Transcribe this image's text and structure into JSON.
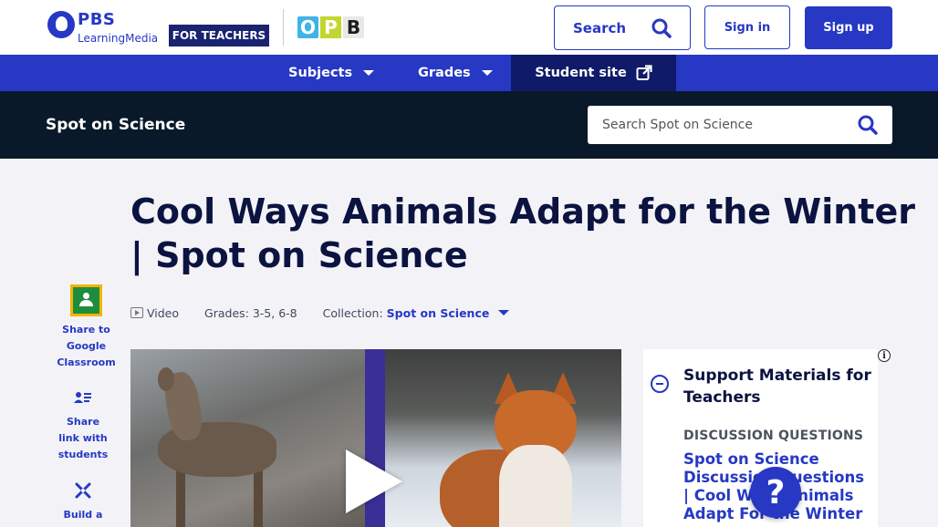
{
  "header": {
    "logo_pbs": "PBS",
    "logo_learning_media": "LearningMedia",
    "for_teachers": "FOR TEACHERS",
    "opb_letters": [
      "O",
      "P",
      "B"
    ],
    "search_label": "Search",
    "sign_in": "Sign in",
    "sign_up": "Sign up"
  },
  "nav": {
    "subjects": "Subjects",
    "grades": "Grades",
    "student_site": "Student site"
  },
  "collection": {
    "title": "Spot on Science",
    "search_placeholder": "Search Spot on Science"
  },
  "page": {
    "title": "Cool Ways Animals Adapt for the Winter | Spot on Science",
    "media_type": "Video",
    "grades": "Grades: 3-5, 6-8",
    "collection_label": "Collection:",
    "collection_link": "Spot on Science"
  },
  "share": {
    "google_classroom": "Share to Google Classroom",
    "share_link": "Share link with students",
    "build": "Build a"
  },
  "support": {
    "title": "Support Materials for Teachers",
    "kicker": "DISCUSSION QUESTIONS",
    "link": "Spot on Science Discussion Questions | Cool Ways Animals Adapt For the Winter"
  },
  "help_label": "?",
  "info_label": "i",
  "colors": {
    "brand_blue": "#2638c4",
    "navy": "#0b1340",
    "collection_bar": "#0a1929",
    "student_site_bg": "#0f1a68"
  }
}
